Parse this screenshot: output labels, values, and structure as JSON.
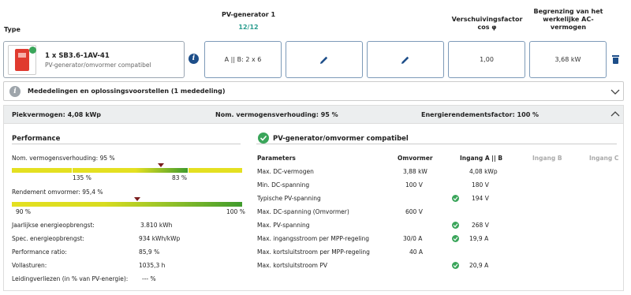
{
  "header": {
    "type_label": "Type",
    "pv_generator_label": "PV-generator 1",
    "pv_generator_count": "12/12",
    "shift_factor_label_1": "Verschuivingsfactor",
    "shift_factor_label_2": "cos φ",
    "limit_label_1": "Begrenzing van het",
    "limit_label_2": "werkelijke AC-",
    "limit_label_3": "vermogen"
  },
  "inverter": {
    "name": "1 x SB3.6-1AV-41",
    "status": "PV-generator/omvormer compatibel",
    "config": "A || B: 2 x 6",
    "cos_phi": "1,00",
    "ac_limit": "3,68 kW"
  },
  "messages": {
    "label": "Mededelingen en oplossingsvoorstellen (1 mededeling)"
  },
  "summary": {
    "peak_power": "Piekvermogen: 4,08 kWp",
    "nominal_ratio": "Nom. vermogensverhouding: 95 %",
    "energy_factor": "Energierendementsfactor: 100 %"
  },
  "performance": {
    "title": "Performance",
    "nominal_ratio_label": "Nom. vermogensverhouding: 95 %",
    "nominal_ratio_value": 0.95,
    "bar1_left": "135 %",
    "bar1_right": "83 %",
    "efficiency_label": "Rendement omvormer: 95,4 %",
    "efficiency_value": 0.954,
    "bar2_left": "90 %",
    "bar2_right": "100 %",
    "rows": [
      {
        "label": "Jaarlijkse energieopbrengst:",
        "value": "3.810 kWh"
      },
      {
        "label": "Spec. energieopbrengst:",
        "value": "934 kWh/kWp"
      },
      {
        "label": "Performance ratio:",
        "value": "85,9 %"
      },
      {
        "label": "Vollasturen:",
        "value": "1035,3 h"
      },
      {
        "label": "Leidingverliezen (in % van PV-energie):",
        "value": "--- %"
      }
    ]
  },
  "compat": {
    "title": "PV-generator/omvormer compatibel",
    "col_params": "Parameters",
    "col_inverter": "Omvormer",
    "col_a_b": "Ingang A || B",
    "col_b": "Ingang B",
    "col_c": "Ingang C",
    "rows": [
      {
        "param": "Max. DC-vermogen",
        "inverter": "3,88 kW",
        "check": false,
        "ab": "4,08 kWp"
      },
      {
        "param": "Min. DC-spanning",
        "inverter": "100 V",
        "check": false,
        "ab": "180 V"
      },
      {
        "param": "Typische PV-spanning",
        "inverter": "",
        "check": true,
        "ab": "194 V"
      },
      {
        "param": "Max. DC-spanning (Omvormer)",
        "inverter": "600 V",
        "check": false,
        "ab": ""
      },
      {
        "param": "Max. PV-spanning",
        "inverter": "",
        "check": true,
        "ab": "268 V"
      },
      {
        "param": "Max. ingangsstroom per MPP-regeling",
        "inverter": "30/0 A",
        "check": true,
        "ab": "19,9 A"
      },
      {
        "param": "Max. kortsluitstroom per MPP-regeling",
        "inverter": "40 A",
        "check": false,
        "ab": ""
      },
      {
        "param": "Max. kortsluitstroom PV",
        "inverter": "",
        "check": true,
        "ab": "20,9 A"
      }
    ]
  },
  "colors": {
    "accent": "#2a9d8f",
    "box_border": "#7d9ab8",
    "check_green": "#3aa55a",
    "info_blue": "#1d4e89"
  }
}
